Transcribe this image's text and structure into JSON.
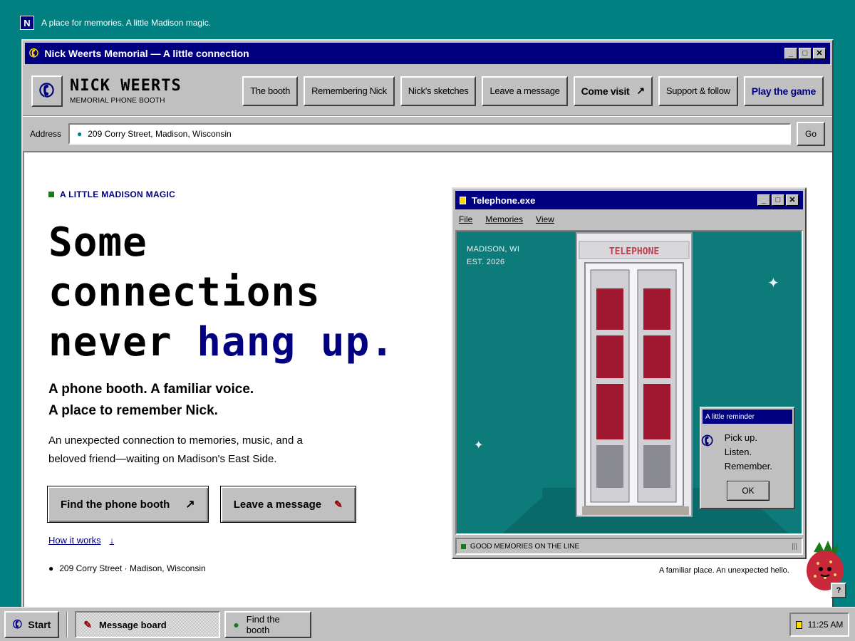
{
  "desktop": {
    "label": "A place for memories. A little Madison magic.",
    "icon_letter": "N"
  },
  "window": {
    "title": "Nick Weerts Memorial — A little connection"
  },
  "brand": {
    "name": "NICK WEERTS",
    "subtitle": "MEMORIAL PHONE BOOTH"
  },
  "nav": {
    "items": [
      {
        "label": "The booth"
      },
      {
        "label": "Remembering Nick"
      },
      {
        "label": "Nick's sketches"
      },
      {
        "label": "Leave a message"
      },
      {
        "label": "Come visit"
      },
      {
        "label": "Support & follow"
      },
      {
        "label": "Play the game"
      }
    ]
  },
  "address_bar": {
    "label": "Address",
    "value": "209 Corry Street, Madison, Wisconsin",
    "go_label": "Go"
  },
  "hero": {
    "eyebrow": "A LITTLE MADISON MAGIC",
    "headline_line1": "Some",
    "headline_line2": "connections",
    "headline_line3_prefix": "never ",
    "headline_line3_accent": "hang up.",
    "subhead_line1": "A phone booth. A familiar voice.",
    "subhead_line2": "A place to remember Nick.",
    "body_line1": "An unexpected connection to memories, music, and a",
    "body_line2": "beloved friend—waiting on Madison's East Side.",
    "cta_primary": "Find the phone booth",
    "cta_secondary": "Leave a message",
    "how_link": "How it works",
    "footer_address": "209 Corry Street · Madison, Wisconsin"
  },
  "telephone_window": {
    "title": "Telephone.exe",
    "menu": [
      "File",
      "Memories",
      "View"
    ],
    "scene_label_line1": "MADISON, WI",
    "scene_label_line2": "EST. 2026",
    "booth_sign": "TELEPHONE",
    "status": "GOOD MEMORIES ON THE LINE"
  },
  "reminder": {
    "title": "A little reminder",
    "line1": "Pick up.",
    "line2": "Listen.",
    "line3": "Remember.",
    "ok_label": "OK"
  },
  "tagline": "A familiar place. An unexpected hello.",
  "help": {
    "label": "?"
  },
  "taskbar": {
    "start_label": "Start",
    "tasks": [
      {
        "label": "Message board",
        "active": true
      },
      {
        "label": "Find the booth",
        "active": false
      }
    ],
    "clock": "11:25 AM"
  },
  "colors": {
    "desktop": "#008080",
    "titlebar": "#000080",
    "accent": "#000080",
    "chrome": "#c0c0c0",
    "scene": "#0e7b7b",
    "booth_glass": "#a01830"
  }
}
